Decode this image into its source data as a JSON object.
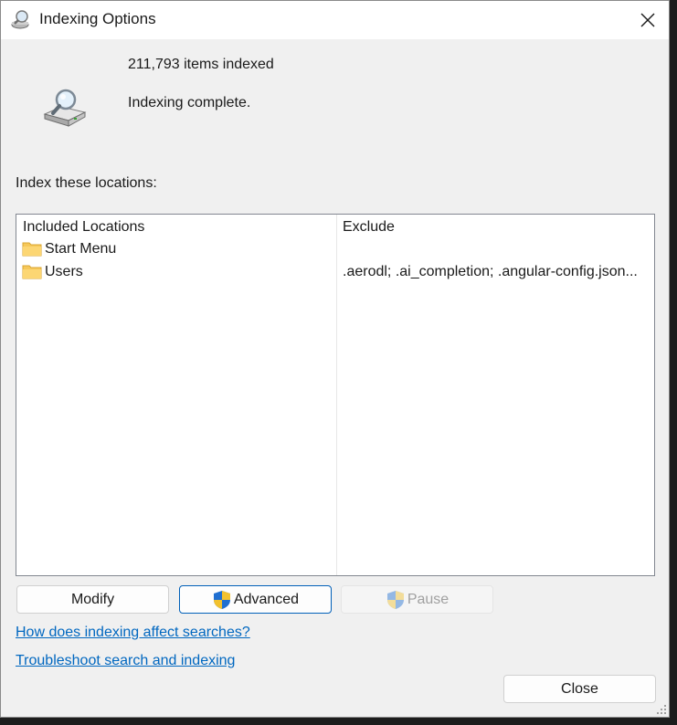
{
  "window": {
    "title": "Indexing Options",
    "title_icon": "indexing-options-icon",
    "close_icon": "close-icon"
  },
  "status": {
    "items_indexed": "211,793 items indexed",
    "state": "Indexing complete.",
    "icon": "drive-magnifier-icon"
  },
  "locations": {
    "section_label": "Index these locations:",
    "columns": [
      "Included Locations",
      "Exclude"
    ],
    "rows": [
      {
        "name": "Start Menu",
        "exclude": "",
        "icon": "folder-icon"
      },
      {
        "name": "Users",
        "exclude": ".aerodl; .ai_completion; .angular-config.json...",
        "icon": "folder-icon"
      }
    ]
  },
  "buttons": {
    "modify": "Modify",
    "advanced": "Advanced",
    "pause": "Pause",
    "close": "Close"
  },
  "links": {
    "how_indexing": "How does indexing affect searches?",
    "troubleshoot": "Troubleshoot search and indexing"
  },
  "colors": {
    "accent": "#005fb8",
    "link": "#0067c0",
    "dialog_bg": "#f0f0f0",
    "disabled_text": "#a0a0a0"
  }
}
